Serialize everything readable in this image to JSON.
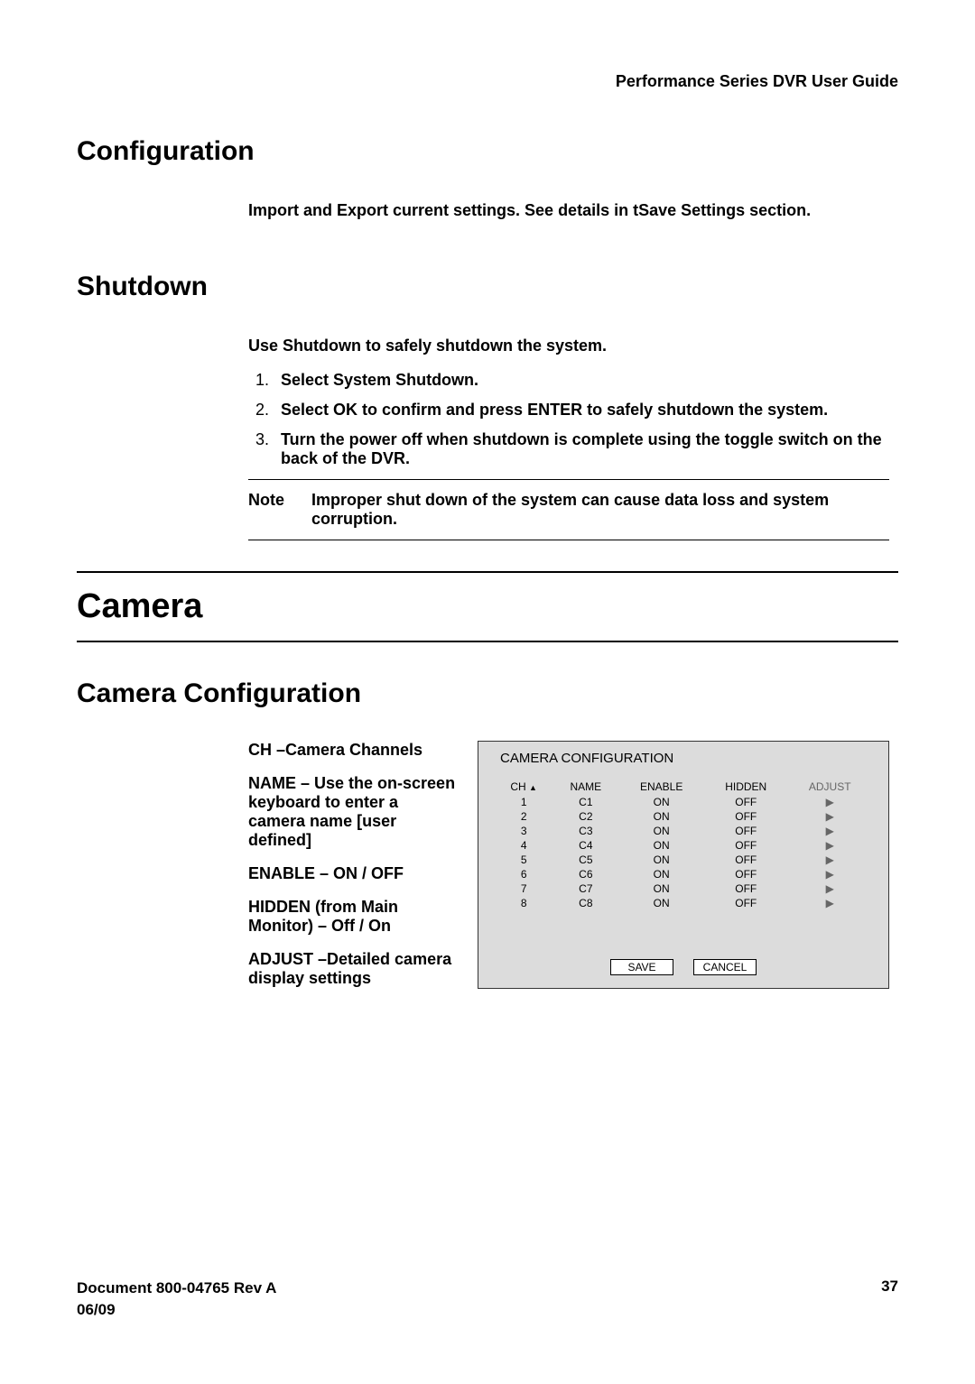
{
  "header": {
    "title": "Performance Series DVR User Guide"
  },
  "config": {
    "heading": "Configuration",
    "text": "Import and Export current settings. See details in tSave Settings section."
  },
  "shutdown": {
    "heading": "Shutdown",
    "intro": "Use Shutdown to safely shutdown the system.",
    "steps": [
      "Select System  Shutdown.",
      "Select OK to confirm and press ENTER to safely shutdown the system.",
      "Turn the power off when shutdown is complete using the toggle switch on the back of the DVR."
    ],
    "note_label": "Note",
    "note_text": "Improper shut down of the system can cause data loss and system corruption."
  },
  "camera": {
    "heading": "Camera",
    "subheading": "Camera Configuration",
    "desc_ch": "CH –Camera Channels",
    "desc_name": "NAME – Use the on-screen keyboard to enter a camera name [user defined]",
    "desc_enable": "ENABLE – ON / OFF",
    "desc_hidden": "HIDDEN (from Main Monitor) – Off / On",
    "desc_adjust": "ADJUST –Detailed camera display settings",
    "panel_title": "CAMERA CONFIGURATION",
    "cols": {
      "ch": "CH",
      "name": "NAME",
      "enable": "ENABLE",
      "hidden": "HIDDEN",
      "adjust": "ADJUST"
    },
    "rows": [
      {
        "ch": "1",
        "name": "C1",
        "enable": "ON",
        "hidden": "OFF"
      },
      {
        "ch": "2",
        "name": "C2",
        "enable": "ON",
        "hidden": "OFF"
      },
      {
        "ch": "3",
        "name": "C3",
        "enable": "ON",
        "hidden": "OFF"
      },
      {
        "ch": "4",
        "name": "C4",
        "enable": "ON",
        "hidden": "OFF"
      },
      {
        "ch": "5",
        "name": "C5",
        "enable": "ON",
        "hidden": "OFF"
      },
      {
        "ch": "6",
        "name": "C6",
        "enable": "ON",
        "hidden": "OFF"
      },
      {
        "ch": "7",
        "name": "C7",
        "enable": "ON",
        "hidden": "OFF"
      },
      {
        "ch": "8",
        "name": "C8",
        "enable": "ON",
        "hidden": "OFF"
      }
    ],
    "save_label": "SAVE",
    "cancel_label": "CANCEL"
  },
  "footer": {
    "doc": "Document 800-04765  Rev A",
    "date": "06/09",
    "page": "37"
  }
}
